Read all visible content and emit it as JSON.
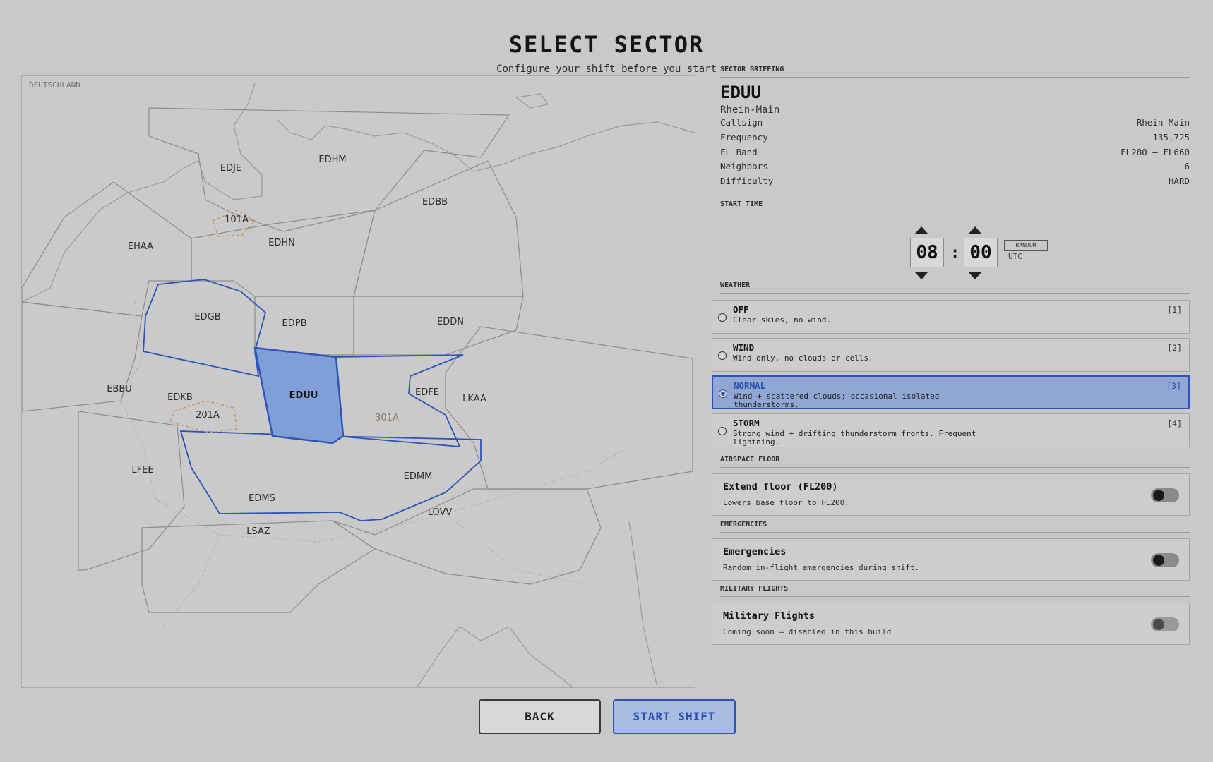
{
  "header": {
    "title": "SELECT SECTOR",
    "subtitle": "Configure your shift before you start"
  },
  "map": {
    "country_label": "DEUTSCHLAND",
    "selected_sector": "EDUU",
    "sectors": [
      "EDJE",
      "EDHM",
      "EDBB",
      "EHAA",
      "EDHN",
      "EDGB",
      "EDPB",
      "EDDN",
      "EBBU",
      "EDKB",
      "EDUU",
      "EDFE",
      "LKAA",
      "LFEE",
      "EDMS",
      "EDMM",
      "LOVV",
      "LSAZ"
    ],
    "restricted_areas": [
      "101A",
      "201A",
      "301A"
    ],
    "colors": {
      "selected_fill": "#7f9fd6",
      "selected_stroke": "#2e54b8",
      "restricted": "#c8925a"
    }
  },
  "briefing": {
    "heading": "SECTOR BRIEFING",
    "code": "EDUU",
    "name": "Rhein-Main",
    "rows": [
      {
        "label": "Callsign",
        "value": "Rhein-Main"
      },
      {
        "label": "Frequency",
        "value": "135.725"
      },
      {
        "label": "FL Band",
        "value": "FL280 – FL660"
      },
      {
        "label": "Neighbors",
        "value": "6"
      },
      {
        "label": "Difficulty",
        "value": "HARD"
      }
    ]
  },
  "start_time": {
    "heading": "START TIME",
    "hours": "08",
    "separator": ":",
    "minutes": "00",
    "random_label": "RANDOM",
    "tz": "UTC"
  },
  "weather": {
    "heading": "WEATHER",
    "options": [
      {
        "name": "OFF",
        "desc": "Clear skies, no wind.",
        "key": "[1]",
        "selected": false
      },
      {
        "name": "WIND",
        "desc": "Wind only, no clouds or cells.",
        "key": "[2]",
        "selected": false
      },
      {
        "name": "NORMAL",
        "desc": "Wind + scattered clouds; occasional isolated thunderstorms.",
        "key": "[3]",
        "selected": true
      },
      {
        "name": "STORM",
        "desc": "Strong wind + drifting thunderstorm fronts. Frequent lightning.",
        "key": "[4]",
        "selected": false
      }
    ]
  },
  "airspace_floor": {
    "heading": "AIRSPACE FLOOR",
    "title": "Extend floor (FL200)",
    "desc": "Lowers base floor to FL200."
  },
  "emergencies": {
    "heading": "EMERGENCIES",
    "title": "Emergencies",
    "desc": "Random in-flight emergencies during shift."
  },
  "military": {
    "heading": "MILITARY FLIGHTS",
    "title": "Military Flights",
    "desc": "Coming soon — disabled in this build"
  },
  "footer": {
    "back_label": "BACK",
    "start_label": "START SHIFT"
  }
}
